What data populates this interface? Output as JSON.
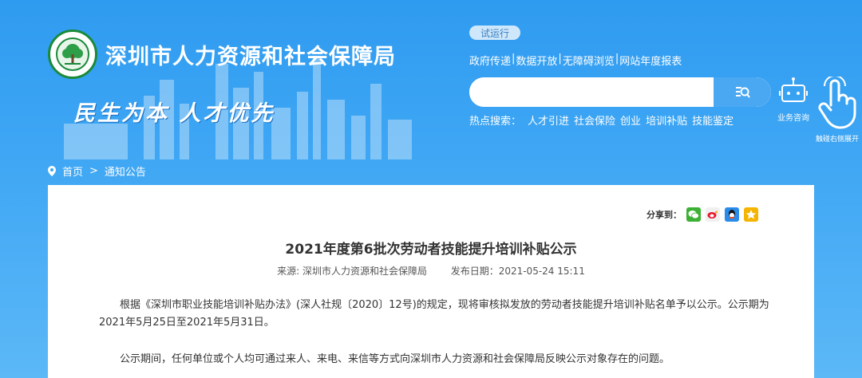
{
  "header": {
    "site_title": "深圳市人力资源和社会保障局",
    "slogan": "民生为本  人才优先",
    "trial_badge": "试运行",
    "top_links": [
      "政府传递",
      "数据开放",
      "无障碍浏览",
      "网站年度报表"
    ],
    "search": {
      "placeholder": "",
      "value": ""
    },
    "hot_label": "热点搜索：",
    "hot_keywords": [
      "人才引进",
      "社会保险",
      "创业",
      "培训补贴",
      "技能鉴定"
    ],
    "robot_label": "业务咨询",
    "hand_label": "触碰右侧展开"
  },
  "breadcrumb": {
    "home": "首页",
    "separator": ">",
    "current": "通知公告"
  },
  "article": {
    "share_label": "分享到：",
    "share_icons": [
      "wechat-icon",
      "weibo-icon",
      "qq-icon",
      "qzone-icon"
    ],
    "title": "2021年度第6批次劳动者技能提升培训补贴公示",
    "source": "来源: 深圳市人力资源和社会保障局",
    "date": "发布日期：2021-05-24 15:11",
    "para1": "根据《深圳市职业技能培训补贴办法》(深人社规〔2020〕12号)的规定，现将审核拟发放的劳动者技能提升培训补贴名单予以公示。公示期为2021年5月25日至2021年5月31日。",
    "para2": "公示期间，任何单位或个人均可通过来人、来电、来信等方式向深圳市人力资源和社会保障局反映公示对象存在的问题。"
  },
  "colors": {
    "background_top": "#2f9bf0",
    "background_bottom": "#5cb8f7",
    "emblem_green": "#1a8a3a",
    "search_button": "#4aa8f2"
  }
}
